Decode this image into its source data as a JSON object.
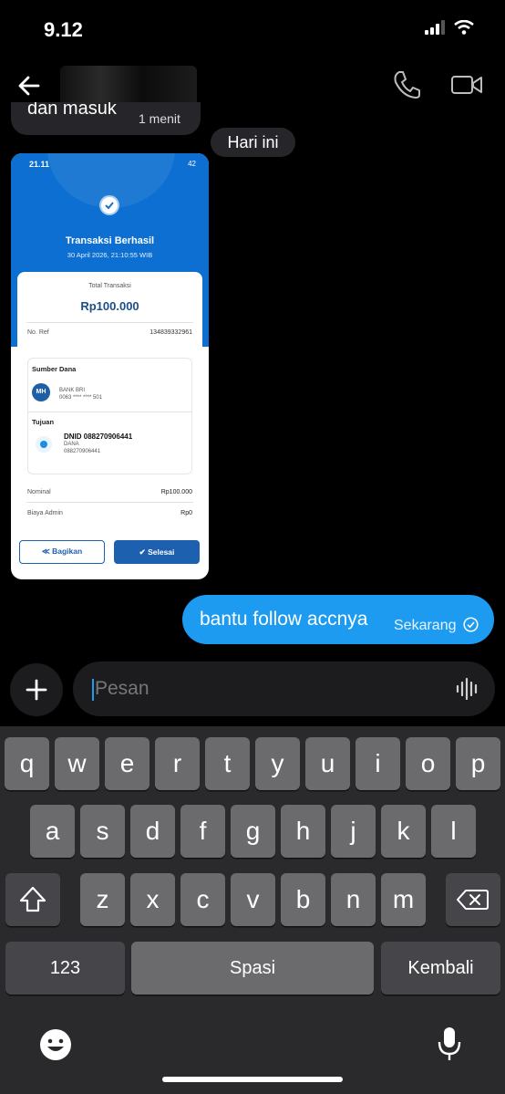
{
  "status_bar": {
    "time": "9.12"
  },
  "chat": {
    "previous_message": {
      "text": "dan masuk",
      "time": "1 menit"
    },
    "date_divider": "Hari ini",
    "receipt_image": {
      "status_time": "21.11",
      "status_battery": "42",
      "title": "Transaksi Berhasil",
      "date": "30 April 2026, 21:10:55 WIB",
      "total_label": "Total Transaksi",
      "total_value": "Rp100.000",
      "ref_label": "No. Ref",
      "ref_value": "134839332961",
      "source_title": "Sumber Dana",
      "source_initials": "MH",
      "source_bank": "BANK BRI",
      "source_account": "0063 **** **** 501",
      "dest_title": "Tujuan",
      "dest_name": "DNID 088270906441",
      "dest_provider": "DANA",
      "dest_account": "088270906441",
      "nominal_label": "Nominal",
      "nominal_value": "Rp100.000",
      "admin_label": "Biaya Admin",
      "admin_value": "Rp0",
      "share_label": "Bagikan",
      "done_label": "Selesai"
    },
    "outgoing_message": {
      "text": "bantu follow accnya",
      "time": "Sekarang"
    }
  },
  "composer": {
    "placeholder": "Pesan"
  },
  "keyboard": {
    "row1": [
      "q",
      "w",
      "e",
      "r",
      "t",
      "y",
      "u",
      "i",
      "o",
      "p"
    ],
    "row2": [
      "a",
      "s",
      "d",
      "f",
      "g",
      "h",
      "j",
      "k",
      "l"
    ],
    "row3": [
      "z",
      "x",
      "c",
      "v",
      "b",
      "n",
      "m"
    ],
    "numbers_label": "123",
    "space_label": "Spasi",
    "return_label": "Kembali"
  },
  "colors": {
    "accent": "#1d9bf0",
    "receipt_blue": "#0d6fd1",
    "keyboard_bg": "#2a2a2c"
  }
}
